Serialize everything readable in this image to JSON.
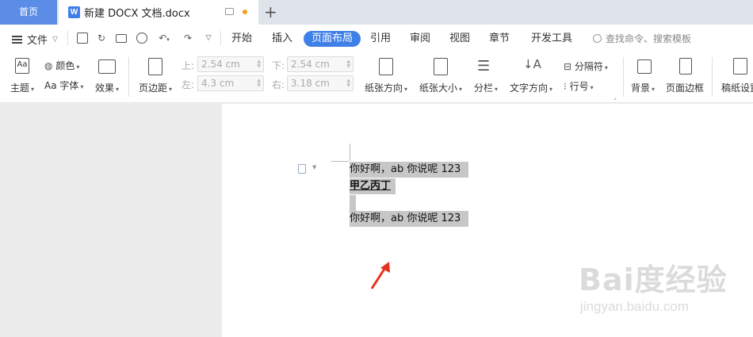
{
  "titlebar": {
    "home_tab": "首页",
    "doc_tab": "新建 DOCX 文档.docx",
    "doc_logo": "W",
    "new_tab": "+"
  },
  "menu": {
    "file": "文件",
    "tabs": [
      "开始",
      "插入",
      "页面布局",
      "引用",
      "审阅",
      "视图",
      "章节",
      "开发工具"
    ],
    "active_tab": "页面布局",
    "search_placeholder": "查找命令、搜索模板"
  },
  "toolbar": {
    "theme": "主题",
    "color": "颜色",
    "font": "字体",
    "effect": "效果",
    "margins": "页边距",
    "margin_top_label": "上:",
    "margin_top": "2.54 cm",
    "margin_bottom_label": "下:",
    "margin_bottom": "2.54 cm",
    "margin_left_label": "左:",
    "margin_left": "4.3 cm",
    "margin_right_label": "右:",
    "margin_right": "3.18 cm",
    "orientation": "纸张方向",
    "paper_size": "纸张大小",
    "columns": "分栏",
    "text_direction": "文字方向",
    "separator": "分隔符",
    "line_number": "行号",
    "background": "背景",
    "page_border": "页面边框",
    "manuscript": "稿纸设置"
  },
  "document": {
    "line1": "你好啊，ab 你说呢 123",
    "line2": "甲乙丙丁",
    "line4": "你好啊，ab 你说呢 123"
  },
  "watermark": {
    "logo": "Bai度经验",
    "url": "jingyan.baidu.com"
  },
  "colors": {
    "accent": "#3f7fe8",
    "home_tab": "#5b8de6",
    "selection": "#c7c7c7",
    "arrow": "#e8321f"
  }
}
